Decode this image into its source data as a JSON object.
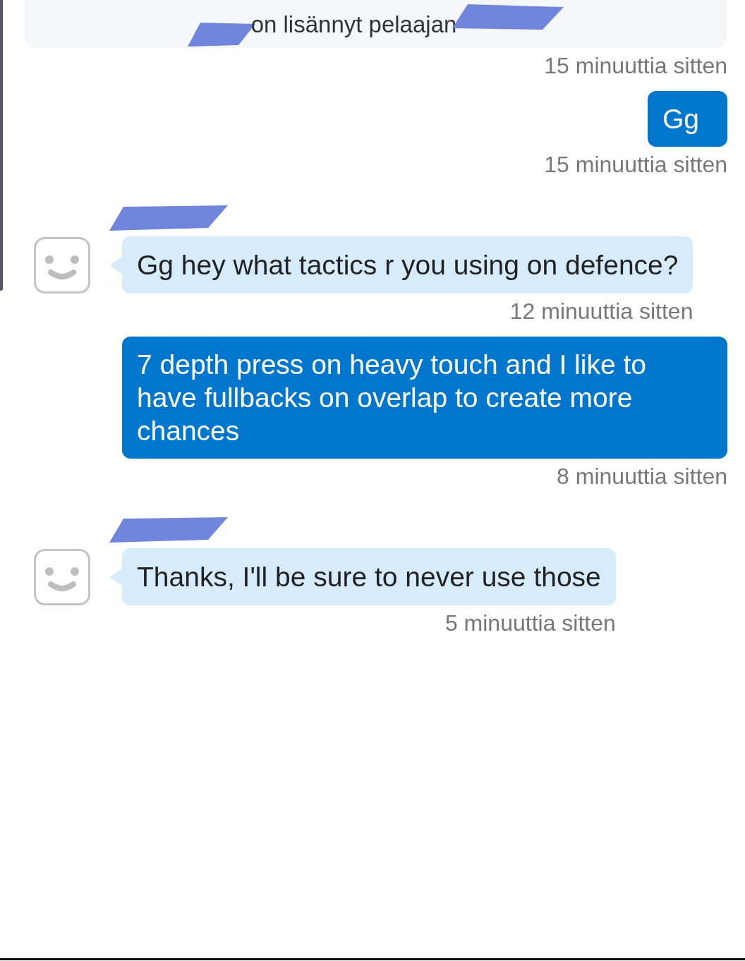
{
  "system_notice": {
    "text": "on lisännyt pelaajan"
  },
  "messages": [
    {
      "kind": "timestamp_only",
      "time": "15 minuuttia sitten"
    },
    {
      "kind": "outgoing",
      "text": "Gg",
      "time": "15 minuuttia sitten"
    },
    {
      "kind": "incoming",
      "text": "Gg hey what tactics r you using on defence?",
      "time": "12 minuuttia sitten"
    },
    {
      "kind": "outgoing",
      "text": "7 depth press on heavy touch and I like to have fullbacks on overlap to create more chances",
      "time": "8 minuuttia sitten"
    },
    {
      "kind": "incoming",
      "text": "Thanks, I'll be sure to never use those",
      "time": "5 minuuttia sitten"
    }
  ]
}
